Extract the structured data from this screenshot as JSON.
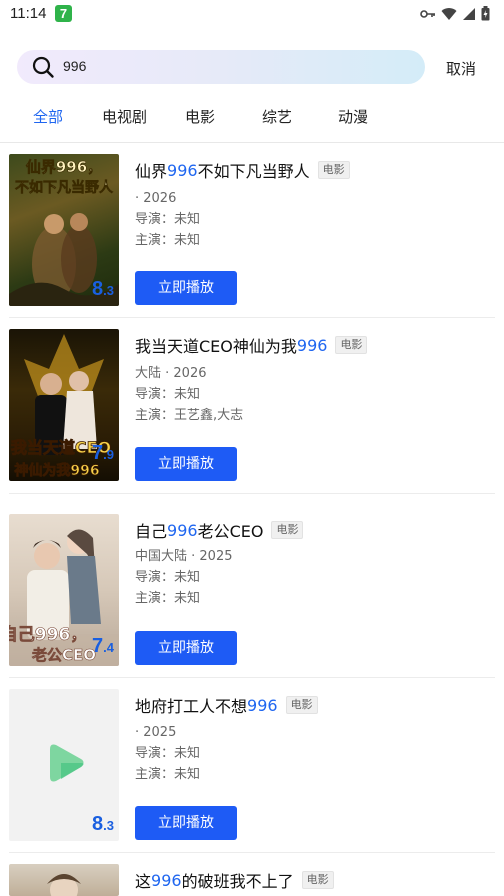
{
  "status": {
    "time": "11:14",
    "badge": "7"
  },
  "search": {
    "value": "996",
    "cancel_label": "取消"
  },
  "tabs": [
    {
      "label": "全部",
      "active": true
    },
    {
      "label": "电视剧",
      "active": false
    },
    {
      "label": "电影",
      "active": false
    },
    {
      "label": "综艺",
      "active": false
    },
    {
      "label": "动漫",
      "active": false
    }
  ],
  "results": [
    {
      "title_pre": "仙界",
      "title_kw": "996",
      "title_post": "不如下凡当野人",
      "type": "电影",
      "region_year": "· 2026",
      "director": "导演：未知",
      "cast": "主演：未知",
      "score_int": "8",
      "score_dec": ".3",
      "poster_text": "仙界996，不如下凡当野人",
      "play_label": "立即播放"
    },
    {
      "title_pre": "我当天道CEO神仙为我",
      "title_kw": "996",
      "title_post": "",
      "type": "电影",
      "region_year": "大陆 · 2026",
      "director": "导演：未知",
      "cast": "主演：王艺鑫,大志",
      "score_int": "7",
      "score_dec": ".9",
      "poster_text": "我当天道CEO 神仙为我996",
      "play_label": "立即播放"
    },
    {
      "title_pre": "自己",
      "title_kw": "996",
      "title_post": "老公CEO",
      "type": "电影",
      "region_year": "中国大陆 · 2025",
      "director": "导演：未知",
      "cast": "主演：未知",
      "score_int": "7",
      "score_dec": ".4",
      "poster_text": "自己996，老公CEO",
      "play_label": "立即播放"
    },
    {
      "title_pre": "地府打工人不想",
      "title_kw": "996",
      "title_post": "",
      "type": "电影",
      "region_year": "· 2025",
      "director": "导演：未知",
      "cast": "主演：未知",
      "score_int": "8",
      "score_dec": ".3",
      "poster_text": "",
      "play_label": "立即播放"
    },
    {
      "title_pre": "这",
      "title_kw": "996",
      "title_post": "的破班我不上了",
      "type": "电影"
    }
  ],
  "colors": {
    "accent": "#1f66f0",
    "button": "#1e5bf5",
    "score": "#1a5fe0"
  }
}
